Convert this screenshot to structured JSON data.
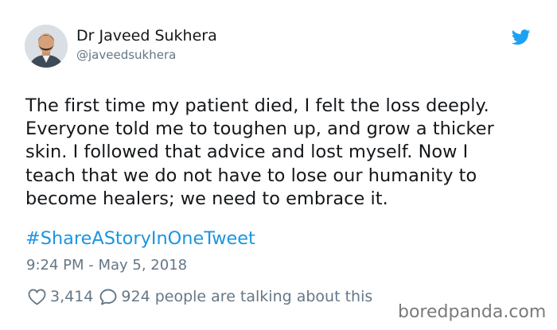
{
  "author": {
    "name": "Dr Javeed Sukhera",
    "handle": "@javeedsukhera",
    "avatar_icon": "profile-photo"
  },
  "tweet": {
    "lines": [
      "The first time my patient died, I felt the loss deeply.",
      "Everyone told me to toughen up, and grow a thicker",
      "skin. I followed that advice and lost myself. Now I",
      "teach that we do not have to lose our humanity to",
      "become healers; we need to embrace it."
    ],
    "hashtag": "#ShareAStoryInOneTweet",
    "timestamp": "9:24 PM - May 5, 2018"
  },
  "engagement": {
    "likes": "3,414",
    "talking": "924 people are talking about this"
  },
  "watermark": "boredpanda.com",
  "colors": {
    "twitter_blue": "#1da1f2",
    "hashtag_blue": "#1b95e0",
    "text_primary": "#14171a",
    "text_secondary": "#657786"
  }
}
